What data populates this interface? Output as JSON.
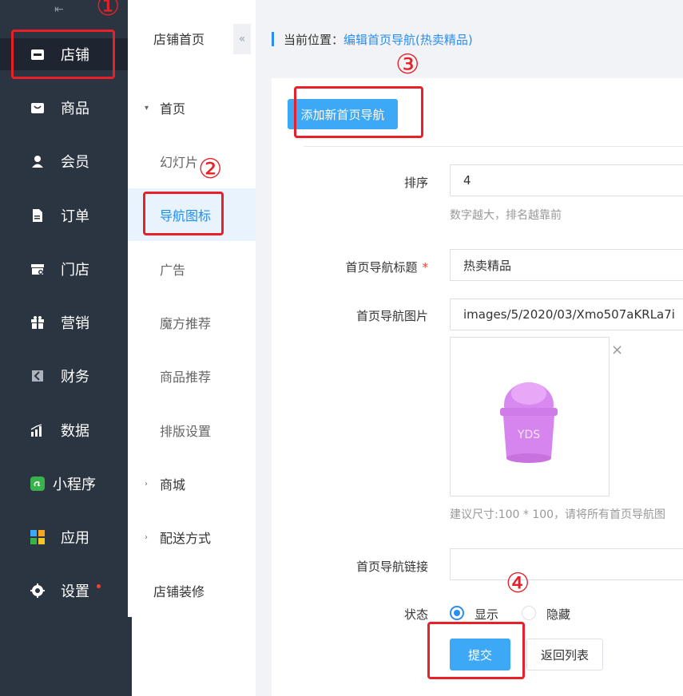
{
  "sidebar": {
    "collapse_glyph": "⇤",
    "items": [
      {
        "label": "店铺",
        "icon": "store-icon"
      },
      {
        "label": "商品",
        "icon": "bag-icon"
      },
      {
        "label": "会员",
        "icon": "user-icon"
      },
      {
        "label": "订单",
        "icon": "document-icon"
      },
      {
        "label": "门店",
        "icon": "shop-icon"
      },
      {
        "label": "营销",
        "icon": "gift-icon"
      },
      {
        "label": "财务",
        "icon": "finance-icon"
      },
      {
        "label": "数据",
        "icon": "chart-icon"
      },
      {
        "label": "小程序",
        "icon": "miniprogram-icon"
      },
      {
        "label": "应用",
        "icon": "apps-icon"
      },
      {
        "label": "设置",
        "icon": "gear-icon"
      }
    ]
  },
  "submenu": {
    "title": "店铺首页",
    "collapse_glyph": "«",
    "groups": [
      {
        "label": "首页",
        "caret": "▾"
      },
      {
        "label": "商城",
        "caret": "›"
      },
      {
        "label": "配送方式",
        "caret": "›"
      }
    ],
    "items": [
      "幻灯片",
      "导航图标",
      "广告",
      "魔方推荐",
      "商品推荐",
      "排版设置"
    ],
    "footer": "店铺装修"
  },
  "breadcrumb": {
    "label": "当前位置：",
    "link": "编辑首页导航(热卖精品)"
  },
  "form": {
    "add_button": "添加新首页导航",
    "sort_label": "排序",
    "sort_value": "4",
    "sort_hint": "数字越大，排名越靠前",
    "title_label": "首页导航标题",
    "required_mark": "*",
    "title_value": "热卖精品",
    "image_label": "首页导航图片",
    "image_value": "images/5/2020/03/Xmo507aKRLa7i",
    "image_close": "×",
    "image_hint": "建议尺寸:100 * 100，请将所有首页导航图",
    "link_label": "首页导航链接",
    "link_value": "",
    "status_label": "状态",
    "status_show": "显示",
    "status_hide": "隐藏",
    "submit": "提交",
    "back": "返回列表"
  },
  "annotations": [
    "①",
    "②",
    "③",
    "④"
  ],
  "colors": {
    "accent": "#3da8f5",
    "highlight": "#e8202a",
    "sidebar": "#2b3441"
  }
}
